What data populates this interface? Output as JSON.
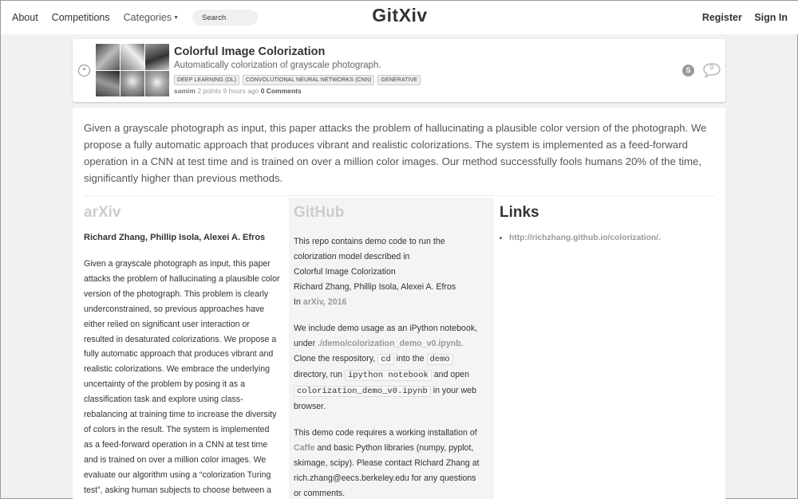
{
  "nav": {
    "about": "About",
    "competitions": "Competitions",
    "categories": "Categories",
    "search_placeholder": "Search",
    "logo": "GitXiv",
    "register": "Register",
    "sign_in": "Sign In"
  },
  "post": {
    "title": "Colorful Image Colorization",
    "subtitle": "Automatically colorization of grayscale photograph.",
    "tags": [
      "DEEP LEARNING (DL)",
      "CONVOLUTIONAL NEURAL NETWORKS (CNN)",
      "GENERATIVE"
    ],
    "author": "samim",
    "meta": "2 points 9 hours ago",
    "comments_link": "0 Comments",
    "share_letter": "S",
    "comment_count": "0"
  },
  "abstract": "Given a grayscale photograph as input, this paper attacks the problem of hallucinating a plausible color version of the photograph. We propose a fully automatic approach that produces vibrant and realistic colorizations. The system is implemented as a feed-forward operation in a CNN at test time and is trained on over a million color images. Our method successfully fools humans 20% of the time, significantly higher than previous methods.",
  "arxiv": {
    "heading": "arXiv",
    "authors": "Richard Zhang, Phillip Isola, Alexei A. Efros",
    "body": "Given a grayscale photograph as input, this paper attacks the problem of hallucinating a plausible color version of the photograph. This problem is clearly underconstrained, so previous approaches have either relied on significant user interaction or resulted in desaturated colorizations. We propose a fully automatic approach that produces vibrant and realistic colorizations. We embrace the underlying uncertainty of the problem by posing it as a classification task and explore using class-rebalancing at training time to increase the diversity of colors in the result. The system is implemented as a feed-forward operation in a CNN at test time and is trained on over a million color images. We evaluate our algorithm using a “colorization Turing test”, asking human subjects to choose between a"
  },
  "github": {
    "heading": "GitHub",
    "p1_line1": "This repo contains demo code to run the colorization model described in",
    "p1_line2": "Colorful Image Colorization",
    "p1_line3": "Richard Zhang, Phillip Isola, Alexei A. Efros",
    "p1_in": "In",
    "p1_venue": "arXiv, 2016",
    "p2_a": "We include demo usage as an iPython notebook, under",
    "p2_path": "./demo/colorization_demo_v0.ipynb",
    "p2_b": ". Clone the respository,",
    "p2_code1": "cd",
    "p2_c": "into the",
    "p2_code2": "demo",
    "p2_d": "directory, run",
    "p2_code3": "ipython notebook",
    "p2_e": "and open",
    "p2_code4": "colorization_demo_v0.ipynb",
    "p2_f": "in your web browser.",
    "p3_a": "This demo code requires a working installation of",
    "p3_caffe": "Caffe",
    "p3_b": "and basic Python libraries (numpy, pyplot, skimage, scipy). Please contact Richard Zhang at rich.zhang@eecs.berkeley.edu for any questions or comments."
  },
  "links": {
    "heading": "Links",
    "items": [
      "http://richzhang.github.io/colorization/."
    ]
  }
}
